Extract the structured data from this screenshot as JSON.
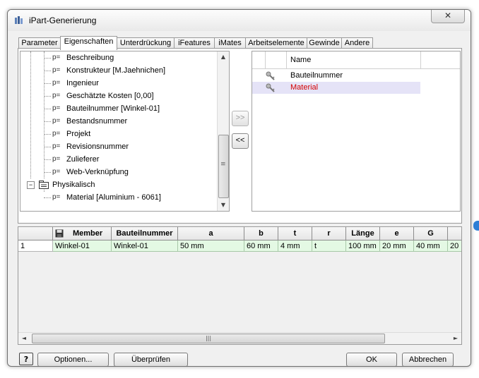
{
  "window": {
    "title": "iPart-Generierung",
    "close_glyph": "✕"
  },
  "tabs": [
    {
      "label": "Parameter",
      "active": false
    },
    {
      "label": "Eigenschaften",
      "active": true
    },
    {
      "label": "Unterdrückung",
      "active": false
    },
    {
      "label": "iFeatures",
      "active": false
    },
    {
      "label": "iMates",
      "active": false
    },
    {
      "label": "Arbeitselemente",
      "active": false
    },
    {
      "label": "Gewinde",
      "active": false
    },
    {
      "label": "Andere",
      "active": false
    }
  ],
  "tree": {
    "prop_icon_text": "p=",
    "items": [
      {
        "label": "Beschreibung"
      },
      {
        "label": "Konstrukteur [M.Jaehnichen]"
      },
      {
        "label": "Ingenieur"
      },
      {
        "label": "Geschätzte Kosten [0,00]"
      },
      {
        "label": "Bauteilnummer [Winkel-01]"
      },
      {
        "label": "Bestandsnummer"
      },
      {
        "label": "Projekt"
      },
      {
        "label": "Revisionsnummer"
      },
      {
        "label": "Zulieferer"
      },
      {
        "label": "Web-Verknüpfung"
      }
    ],
    "group": {
      "label": "Physikalisch",
      "expander": "−"
    },
    "group_items": [
      {
        "label": "Material [Aluminium - 6061]"
      }
    ],
    "scroll_up": "▲",
    "scroll_down": "▼",
    "scroll_grip": "≡"
  },
  "buttons": {
    "add": ">>",
    "remove": "<<",
    "help": "?",
    "options": "Optionen...",
    "check": "Überprüfen",
    "ok": "OK",
    "cancel": "Abbrechen"
  },
  "selected_list": {
    "header": "Name",
    "items": [
      {
        "label": "Bauteilnummer",
        "icon": "key-icon"
      },
      {
        "label": "Material",
        "icon": "key-icon",
        "selected": true
      }
    ]
  },
  "table": {
    "columns": [
      "",
      "Member",
      "Bauteilnummer",
      "a",
      "b",
      "t",
      "r",
      "Länge",
      "e",
      "G",
      ""
    ],
    "rows": [
      [
        "1",
        "Winkel-01",
        "Winkel-01",
        "50 mm",
        "60 mm",
        "4 mm",
        "t",
        "100 mm",
        "20 mm",
        "40 mm",
        "20"
      ]
    ],
    "scroll_left": "◄",
    "scroll_right": "►",
    "scroll_grip": "|||"
  },
  "colors": {
    "selected_text": "#d40000",
    "selected_bg": "#e5e3f7",
    "row_bg": "#e4f9e4"
  }
}
